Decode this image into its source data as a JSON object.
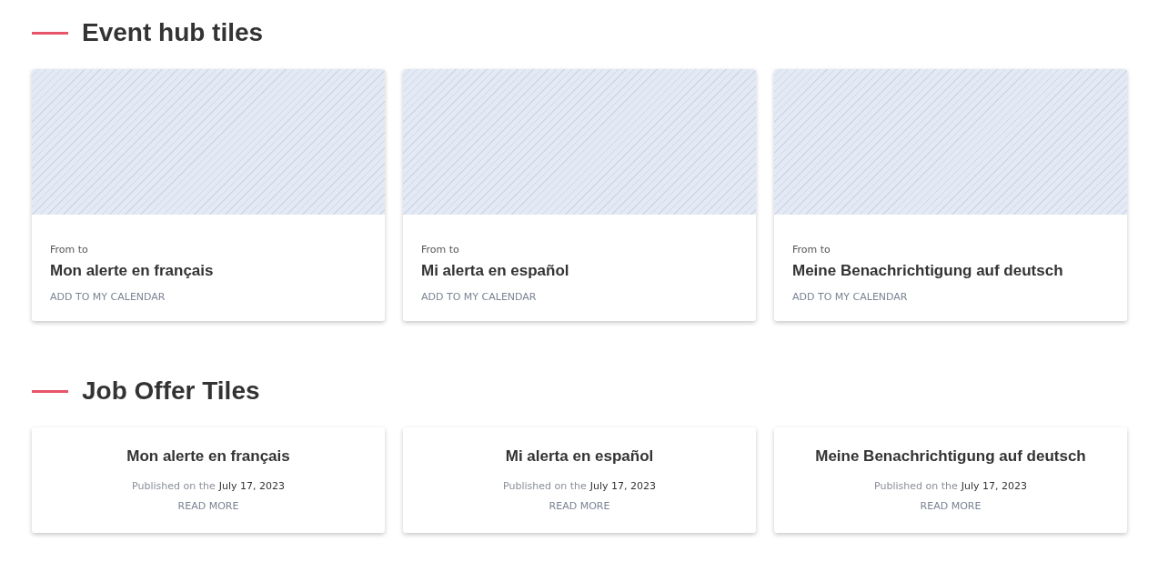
{
  "sections": [
    {
      "kind": "event",
      "title": "Event hub tiles",
      "tiles": [
        {
          "date_label": "From to",
          "title": "Mon alerte en français",
          "link": "ADD TO MY CALENDAR"
        },
        {
          "date_label": "From to",
          "title": "Mi alerta en español",
          "link": "ADD TO MY CALENDAR"
        },
        {
          "date_label": "From to",
          "title": "Meine Benachrichtigung auf deutsch",
          "link": "ADD TO MY CALENDAR"
        }
      ]
    },
    {
      "kind": "job",
      "title": "Job Offer Tiles",
      "tiles": [
        {
          "title": "Mon alerte en français",
          "published_label": "Published on the",
          "date": "July 17, 2023",
          "link": "READ MORE"
        },
        {
          "title": "Mi alerta en español",
          "published_label": "Published on the",
          "date": "July 17, 2023",
          "link": "READ MORE"
        },
        {
          "title": "Meine Benachrichtigung auf deutsch",
          "published_label": "Published on the",
          "date": "July 17, 2023",
          "link": "READ MORE"
        }
      ]
    }
  ]
}
